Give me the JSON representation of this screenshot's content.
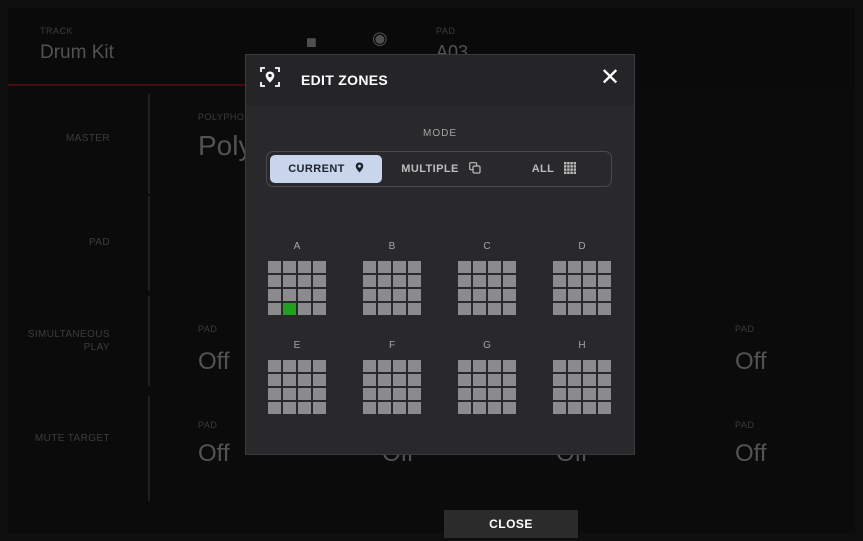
{
  "background": {
    "track_label": "TRACK",
    "track_name": "Drum Kit",
    "pad_label": "PAD",
    "pad_value": "A03",
    "sections": [
      "MASTER",
      "PAD",
      "SIMULTANEOUS PLAY",
      "MUTE TARGET"
    ],
    "polyphony_label": "POLYPHONY",
    "polyphony_value": "Poly",
    "field_pad_label": "PAD",
    "off_value": "Off"
  },
  "modal": {
    "title": "EDIT ZONES",
    "mode_label": "MODE",
    "modes": [
      {
        "label": "CURRENT",
        "icon": "location-pin-icon",
        "active": true
      },
      {
        "label": "MULTIPLE",
        "icon": "copy-icon",
        "active": false
      },
      {
        "label": "ALL",
        "icon": "grid-icon",
        "active": false
      }
    ],
    "zones": [
      {
        "label": "A",
        "selected_pad": 13
      },
      {
        "label": "B",
        "selected_pad": null
      },
      {
        "label": "C",
        "selected_pad": null
      },
      {
        "label": "D",
        "selected_pad": null
      },
      {
        "label": "E",
        "selected_pad": null
      },
      {
        "label": "F",
        "selected_pad": null
      },
      {
        "label": "G",
        "selected_pad": null
      },
      {
        "label": "H",
        "selected_pad": null
      }
    ]
  },
  "footer": {
    "close_label": "CLOSE"
  },
  "colors": {
    "accent_red": "#b4202a",
    "selected_pad": "#1fa021",
    "active_mode_bg": "#c9d5ea"
  }
}
